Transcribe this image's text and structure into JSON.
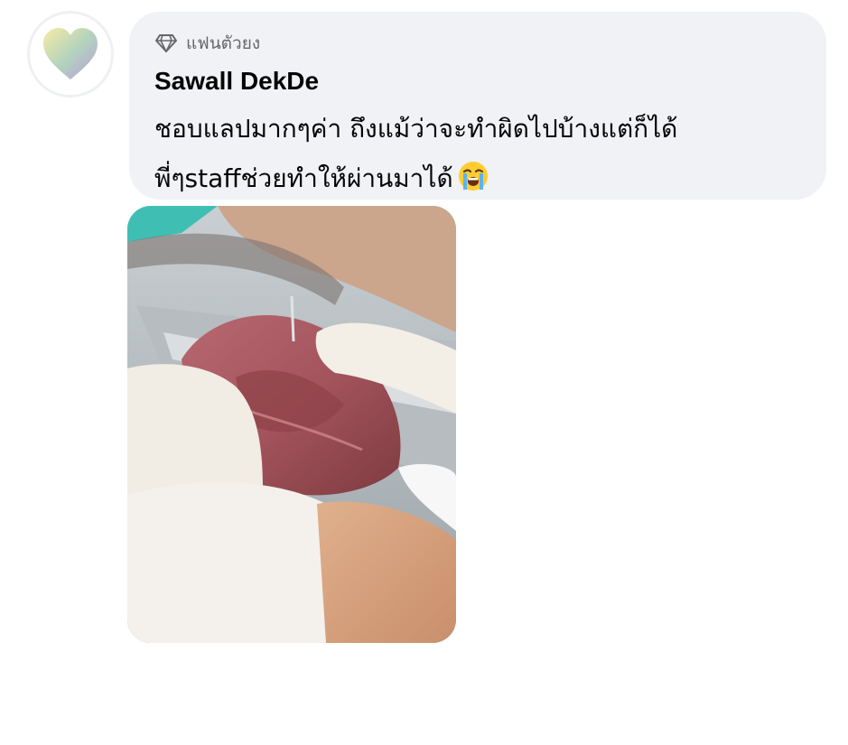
{
  "comment": {
    "badge_icon": "diamond-icon",
    "badge_label": "แฟนตัวยง",
    "author_name": "Sawall DekDe",
    "text_line_1": "ชอบแลปมากๆค่า ถึงแม้ว่าจะทำผิดไปบ้างแต่ก็ได้",
    "text_line_2": "พี่ๆstaffช่วยทำให้ผ่านมาได้",
    "emoji": "loudly-crying-face"
  },
  "avatar": {
    "icon": "heart-icon",
    "colors": [
      "#f3e6a3",
      "#b5d1b8",
      "#b9a6d6"
    ]
  },
  "photo": {
    "subject": "gloved hands holding dissected organ tissue"
  }
}
